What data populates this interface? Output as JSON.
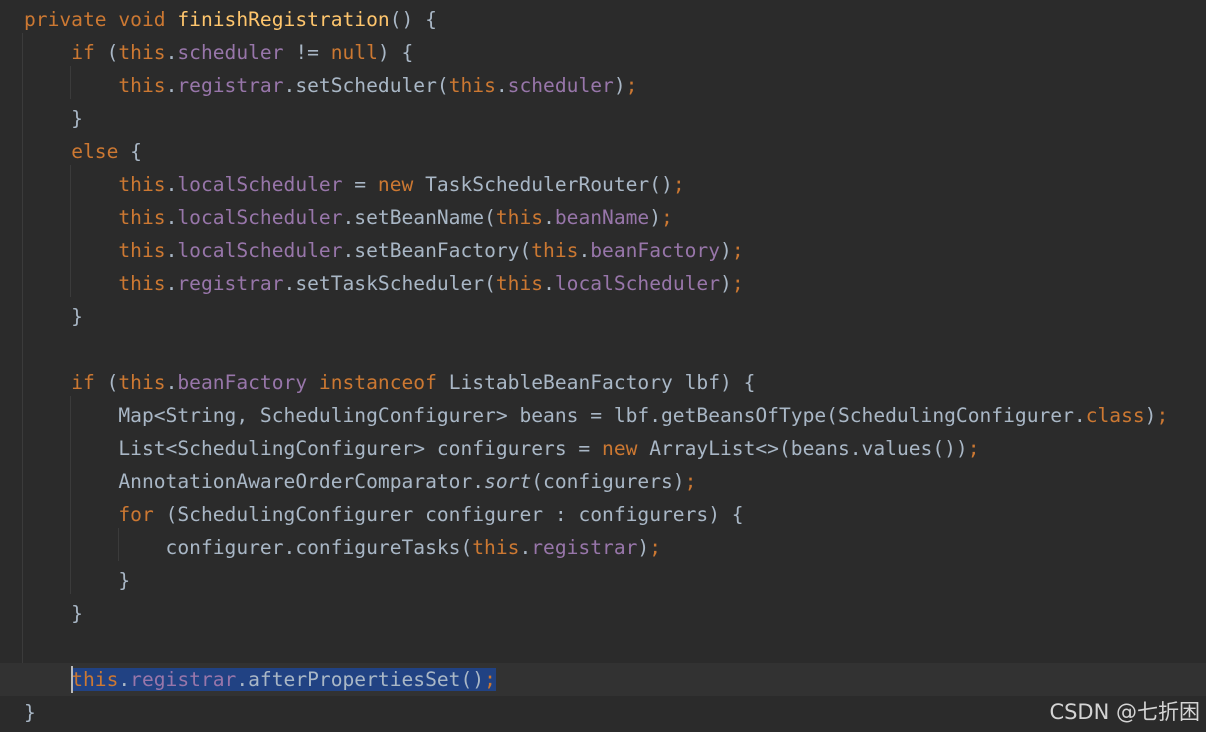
{
  "code_lines": [
    [
      [
        "private void ",
        "kw"
      ],
      [
        "finishRegistration",
        "fn"
      ],
      [
        "() {",
        ""
      ]
    ],
    [
      [
        "    ",
        ""
      ],
      [
        "if ",
        "kw"
      ],
      [
        "(",
        ""
      ],
      [
        "this",
        "kw"
      ],
      [
        ".",
        ""
      ],
      [
        "scheduler",
        "fld"
      ],
      [
        " != ",
        ""
      ],
      [
        "null",
        "kw"
      ],
      [
        ") {",
        ""
      ]
    ],
    [
      [
        "        ",
        ""
      ],
      [
        "this",
        "kw"
      ],
      [
        ".",
        ""
      ],
      [
        "registrar",
        "fld"
      ],
      [
        ".setScheduler(",
        ""
      ],
      [
        "this",
        "kw"
      ],
      [
        ".",
        ""
      ],
      [
        "scheduler",
        "fld"
      ],
      [
        ")",
        ""
      ],
      [
        ";",
        "kw"
      ]
    ],
    [
      [
        "    }",
        ""
      ]
    ],
    [
      [
        "    ",
        ""
      ],
      [
        "else ",
        "kw"
      ],
      [
        "{",
        ""
      ]
    ],
    [
      [
        "        ",
        ""
      ],
      [
        "this",
        "kw"
      ],
      [
        ".",
        ""
      ],
      [
        "localScheduler",
        "fld"
      ],
      [
        " = ",
        ""
      ],
      [
        "new ",
        "kw"
      ],
      [
        "TaskSchedulerRouter()",
        ""
      ],
      [
        ";",
        "kw"
      ]
    ],
    [
      [
        "        ",
        ""
      ],
      [
        "this",
        "kw"
      ],
      [
        ".",
        ""
      ],
      [
        "localScheduler",
        "fld"
      ],
      [
        ".setBeanName(",
        ""
      ],
      [
        "this",
        "kw"
      ],
      [
        ".",
        ""
      ],
      [
        "beanName",
        "fld"
      ],
      [
        ")",
        ""
      ],
      [
        ";",
        "kw"
      ]
    ],
    [
      [
        "        ",
        ""
      ],
      [
        "this",
        "kw"
      ],
      [
        ".",
        ""
      ],
      [
        "localScheduler",
        "fld"
      ],
      [
        ".setBeanFactory(",
        ""
      ],
      [
        "this",
        "kw"
      ],
      [
        ".",
        ""
      ],
      [
        "beanFactory",
        "fld"
      ],
      [
        ")",
        ""
      ],
      [
        ";",
        "kw"
      ]
    ],
    [
      [
        "        ",
        ""
      ],
      [
        "this",
        "kw"
      ],
      [
        ".",
        ""
      ],
      [
        "registrar",
        "fld"
      ],
      [
        ".setTaskScheduler(",
        ""
      ],
      [
        "this",
        "kw"
      ],
      [
        ".",
        ""
      ],
      [
        "localScheduler",
        "fld"
      ],
      [
        ")",
        ""
      ],
      [
        ";",
        "kw"
      ]
    ],
    [
      [
        "    }",
        ""
      ]
    ],
    [
      [
        "",
        ""
      ]
    ],
    [
      [
        "    ",
        ""
      ],
      [
        "if ",
        "kw"
      ],
      [
        "(",
        ""
      ],
      [
        "this",
        "kw"
      ],
      [
        ".",
        ""
      ],
      [
        "beanFactory ",
        "fld"
      ],
      [
        "instanceof ",
        "kw"
      ],
      [
        "ListableBeanFactory lbf) {",
        ""
      ]
    ],
    [
      [
        "        Map<String, SchedulingConfigurer> beans = lbf.getBeansOfType(SchedulingConfigurer.",
        ""
      ],
      [
        "class",
        "kw"
      ],
      [
        ")",
        ""
      ],
      [
        ";",
        "kw"
      ]
    ],
    [
      [
        "        List<SchedulingConfigurer> configurers = ",
        ""
      ],
      [
        "new ",
        "kw"
      ],
      [
        "ArrayList<>(beans.values())",
        ""
      ],
      [
        ";",
        "kw"
      ]
    ],
    [
      [
        "        AnnotationAwareOrderComparator.",
        ""
      ],
      [
        "sort",
        "it"
      ],
      [
        "(configurers)",
        ""
      ],
      [
        ";",
        "kw"
      ]
    ],
    [
      [
        "        ",
        ""
      ],
      [
        "for ",
        "kw"
      ],
      [
        "(SchedulingConfigurer configurer : configurers) {",
        ""
      ]
    ],
    [
      [
        "            configurer.configureTasks(",
        ""
      ],
      [
        "this",
        "kw"
      ],
      [
        ".",
        ""
      ],
      [
        "registrar",
        "fld"
      ],
      [
        ")",
        ""
      ],
      [
        ";",
        "kw"
      ]
    ],
    [
      [
        "        }",
        ""
      ]
    ],
    [
      [
        "    }",
        ""
      ]
    ],
    [
      [
        "",
        ""
      ]
    ],
    [
      [
        "    ",
        ""
      ],
      [
        "this",
        "kw sel"
      ],
      [
        ".",
        "sel"
      ],
      [
        "registrar",
        "fld sel"
      ],
      [
        ".afterPropertiesSet()",
        "sel"
      ],
      [
        ";",
        "kw sel"
      ]
    ],
    [
      [
        "}",
        ""
      ]
    ]
  ],
  "current_line_index": 20,
  "watermark": "CSDN @七折困",
  "colors": {
    "background": "#2b2b2b",
    "current_line": "#323232",
    "selection": "#214283",
    "keyword": "#cc7832",
    "field": "#9876aa",
    "method_declaration": "#ffc66d",
    "plain": "#a9b7c6"
  }
}
